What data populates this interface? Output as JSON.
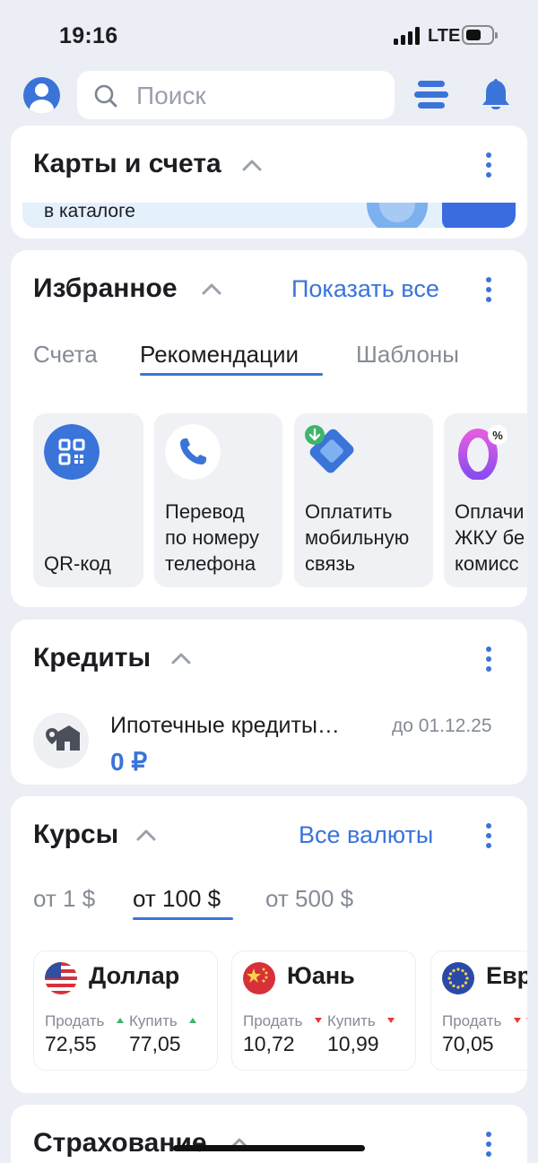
{
  "status_bar": {
    "time": "19:16",
    "network": "LTE"
  },
  "search": {
    "placeholder": "Поиск"
  },
  "cards_accounts": {
    "title": "Карты и счета",
    "banner_text": "в каталоге"
  },
  "favorites": {
    "title": "Избранное",
    "show_all": "Показать все",
    "tabs": [
      {
        "label": "Счета",
        "active": false
      },
      {
        "label": "Рекомендации",
        "active": true
      },
      {
        "label": "Шаблоны",
        "active": false
      }
    ],
    "tiles": [
      {
        "label": "QR-код",
        "icon": "qr-code-icon"
      },
      {
        "label": "Перевод\nпо номеру\nтелефона",
        "icon": "phone-icon"
      },
      {
        "label": "Оплатить\nмобильную\nсвязь",
        "icon": "sim-card-icon"
      },
      {
        "label": "Оплачи\nЖКУ бе\nкомисс",
        "icon": "zero-percent-icon"
      }
    ]
  },
  "credits": {
    "title": "Кредиты",
    "items": [
      {
        "name": "Ипотечные кредиты…",
        "due": "до 01.12.25",
        "amount": "0 ₽",
        "icon": "house-icon"
      }
    ]
  },
  "rates": {
    "title": "Курсы",
    "all_currencies": "Все валюты",
    "tabs": [
      {
        "label": "от 1 $",
        "active": false
      },
      {
        "label": "от 100 $",
        "active": true
      },
      {
        "label": "от 500 $",
        "active": false
      }
    ],
    "currencies": [
      {
        "name": "Доллар",
        "flag": "us-flag-icon",
        "sell_label": "Продать",
        "buy_label": "Купить",
        "sell": "72,55",
        "buy": "77,05",
        "sell_trend": "up",
        "buy_trend": "up"
      },
      {
        "name": "Юань",
        "flag": "cn-flag-icon",
        "sell_label": "Продать",
        "buy_label": "Купить",
        "sell": "10,72",
        "buy": "10,99",
        "sell_trend": "down",
        "buy_trend": "down"
      },
      {
        "name": "Евр",
        "flag": "eu-flag-icon",
        "sell_label": "Продать",
        "buy_label": "",
        "sell": "70,05",
        "buy": "",
        "sell_trend": "down",
        "buy_trend": "down"
      }
    ]
  },
  "insurance": {
    "title": "Страхование"
  },
  "colors": {
    "accent": "#3a74d9",
    "background": "#eceef5",
    "up": "#3db56a",
    "down": "#e23b3b"
  }
}
